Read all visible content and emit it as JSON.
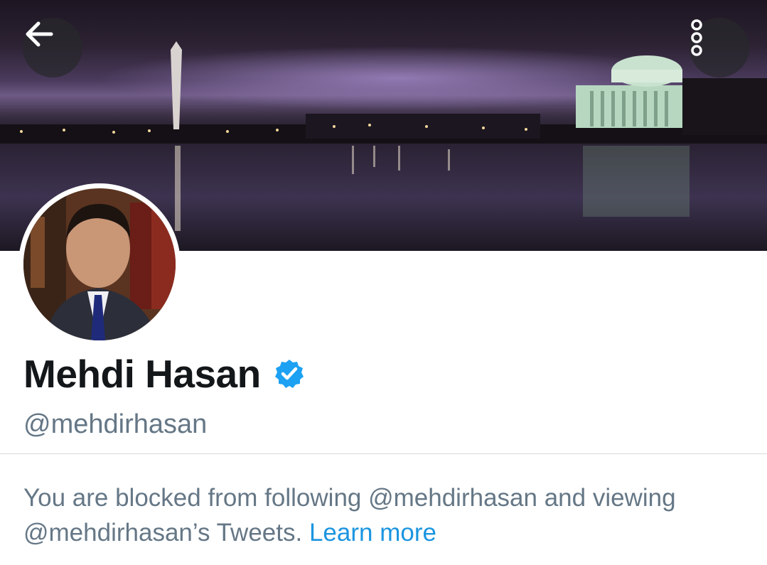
{
  "header": {
    "back_icon": "arrow-left-icon",
    "more_icon": "vertical-dots-icon",
    "banner_icon": "night-cityscape-banner"
  },
  "profile": {
    "avatar_icon": "profile-photo",
    "name": "Mehdi Hasan",
    "verified_icon": "verified-badge-icon",
    "handle": "@mehdirhasan"
  },
  "notice": {
    "text_part1": "You are blocked from following @mehdirhasan and viewing @mehdirhasan’s Tweets.",
    "link": "Learn more"
  },
  "colors": {
    "accent": "#1b95e0",
    "secondary_text": "#657786",
    "primary_text": "#14171a"
  }
}
